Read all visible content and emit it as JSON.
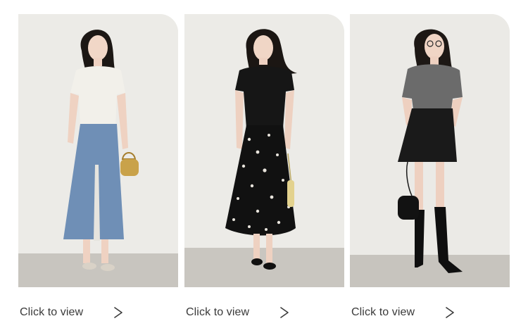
{
  "products": [
    {
      "id": "look-1",
      "colors": {
        "top": "#f2f0ea",
        "bottom": "#6f8fb6",
        "bag": "#c9a24a",
        "shoes": "#d9d2c7"
      },
      "cta_label": "Click to view",
      "cta_arrow": ">"
    },
    {
      "id": "look-2",
      "colors": {
        "top": "#161616",
        "bottom": "#111111",
        "bag": "#e3d28e",
        "shoes": "#111111"
      },
      "cta_label": "Click to view",
      "cta_arrow": ">"
    },
    {
      "id": "look-3",
      "colors": {
        "top": "#6b6b6b",
        "bottom": "#1a1a1a",
        "bag": "#121212",
        "shoes": "#0f0f0f"
      },
      "cta_label": "Click to view",
      "cta_arrow": ">"
    }
  ]
}
